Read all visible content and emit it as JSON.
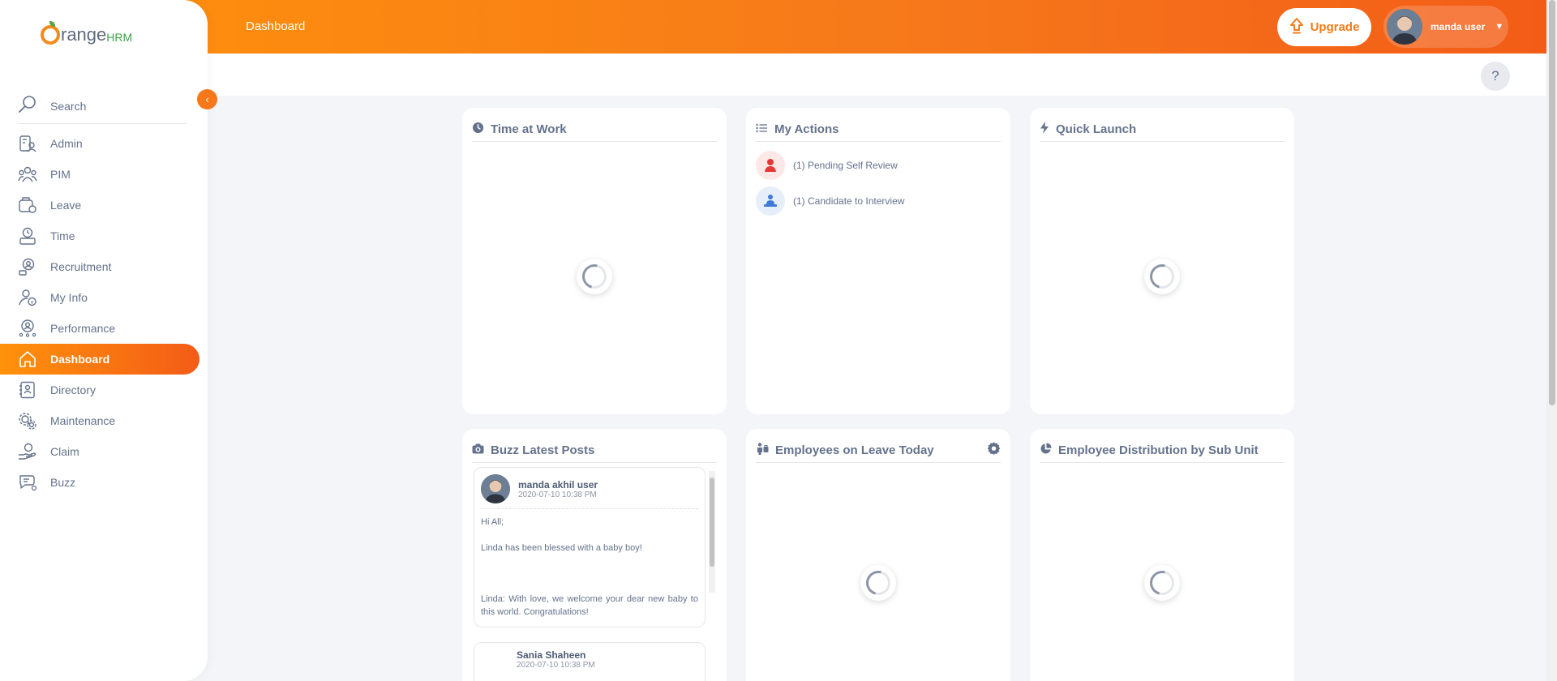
{
  "header": {
    "page_title": "Dashboard",
    "upgrade_label": "Upgrade",
    "user_name": "manda user",
    "help_label": "?"
  },
  "sidebar": {
    "brand_prefix": "range",
    "brand_suffix": "HRM",
    "search_label": "Search",
    "items": [
      {
        "label": "Admin",
        "icon": "admin-icon"
      },
      {
        "label": "PIM",
        "icon": "pim-icon"
      },
      {
        "label": "Leave",
        "icon": "leave-icon"
      },
      {
        "label": "Time",
        "icon": "time-icon"
      },
      {
        "label": "Recruitment",
        "icon": "recruitment-icon"
      },
      {
        "label": "My Info",
        "icon": "my-info-icon"
      },
      {
        "label": "Performance",
        "icon": "performance-icon"
      },
      {
        "label": "Dashboard",
        "icon": "dashboard-icon",
        "active": true
      },
      {
        "label": "Directory",
        "icon": "directory-icon"
      },
      {
        "label": "Maintenance",
        "icon": "maintenance-icon"
      },
      {
        "label": "Claim",
        "icon": "claim-icon"
      },
      {
        "label": "Buzz",
        "icon": "buzz-icon"
      }
    ]
  },
  "widgets": {
    "time_at_work": {
      "title": "Time at Work"
    },
    "my_actions": {
      "title": "My Actions",
      "items": [
        {
          "text": "(1) Pending Self Review",
          "icon": "self-review-icon",
          "color": "#e53935"
        },
        {
          "text": "(1) Candidate to Interview",
          "icon": "interview-icon",
          "color": "#3f7bd6"
        }
      ]
    },
    "quick_launch": {
      "title": "Quick Launch"
    },
    "buzz": {
      "title": "Buzz Latest Posts",
      "posts": [
        {
          "author": "manda akhil user",
          "date": "2020-07-10 10:38 PM",
          "lines": [
            "Hi All;",
            "Linda has been blessed with a baby boy!",
            "Linda: With love, we welcome your dear new baby to this world. Congratulations!"
          ]
        },
        {
          "author": "Sania Shaheen",
          "date": "2020-07-10 10:38 PM"
        }
      ]
    },
    "employees_on_leave": {
      "title": "Employees on Leave Today"
    },
    "distribution": {
      "title": "Employee Distribution by Sub Unit"
    }
  },
  "colors": {
    "accent": "#f6781b",
    "accent_start": "#ff920b",
    "accent_end": "#f35c17",
    "text": "#64728c"
  }
}
